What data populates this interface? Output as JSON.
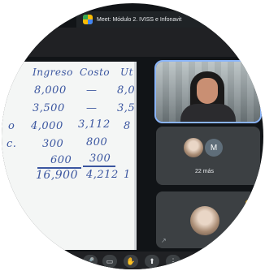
{
  "browser": {
    "tab_title": "Meet: Módulo 2. IVISS e Infonavit"
  },
  "whiteboard": {
    "column_headers": [
      "Ingreso",
      "Costo",
      "Ut"
    ],
    "rows": [
      {
        "label": "",
        "ingreso": "8,000",
        "costo": "—",
        "ut": "8,0"
      },
      {
        "label": "",
        "ingreso": "3,500",
        "costo": "—",
        "ut": "3,5"
      },
      {
        "label": "o",
        "ingreso": "4,000",
        "costo": "3,112",
        "ut": "8"
      },
      {
        "label": "c.",
        "ingreso": "300",
        "costo": "800",
        "ut": ""
      },
      {
        "label": "",
        "ingreso": "600",
        "costo": "300",
        "ut": ""
      }
    ],
    "totals": {
      "ingreso": "16,900",
      "costo": "4,212",
      "ut": "1"
    }
  },
  "participants": {
    "speaker_pin": "✥",
    "avatar_letter": "M",
    "more_count_label": "22 más",
    "tile3_icon": "↗",
    "tile3_hand_icon": "✋"
  },
  "controls": {
    "mic": "🎤",
    "cam": "▭",
    "hand": "✋",
    "present": "⬆",
    "more": "⋮",
    "end": "☎"
  },
  "colors": {
    "ink": "#3b56a0",
    "tile": "#3c4043",
    "active_outline": "#8ab4f8",
    "end_call": "#ea4335"
  }
}
